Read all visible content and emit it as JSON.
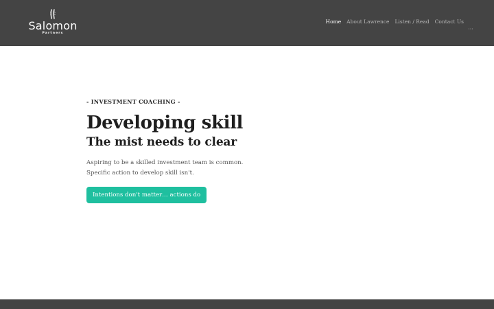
{
  "header": {
    "logo": {
      "name": "Salomon",
      "sub": "Partners"
    },
    "nav": [
      {
        "label": "Home",
        "active": true
      },
      {
        "label": "About Lawrence",
        "active": false
      },
      {
        "label": "Listen / Read",
        "active": false
      },
      {
        "label": "Contact Us",
        "active": false
      }
    ],
    "more_icon": "ellipsis-icon",
    "colors": {
      "header_bg": "#444444",
      "nav_active": "#ffffff",
      "nav_inactive": "#b8b8b8"
    }
  },
  "hero": {
    "eyebrow": "- INVESTMENT COACHING -",
    "headline": "Developing skill",
    "subhead": "The mist needs to clear",
    "body_line1": "Aspiring to be a skilled investment team is common.",
    "body_line2": "Specific action to develop skill isn't.",
    "cta_label": "Intentions don't matter… actions do",
    "colors": {
      "cta_bg": "#1fbf9f",
      "cta_text": "#ffffff"
    }
  }
}
